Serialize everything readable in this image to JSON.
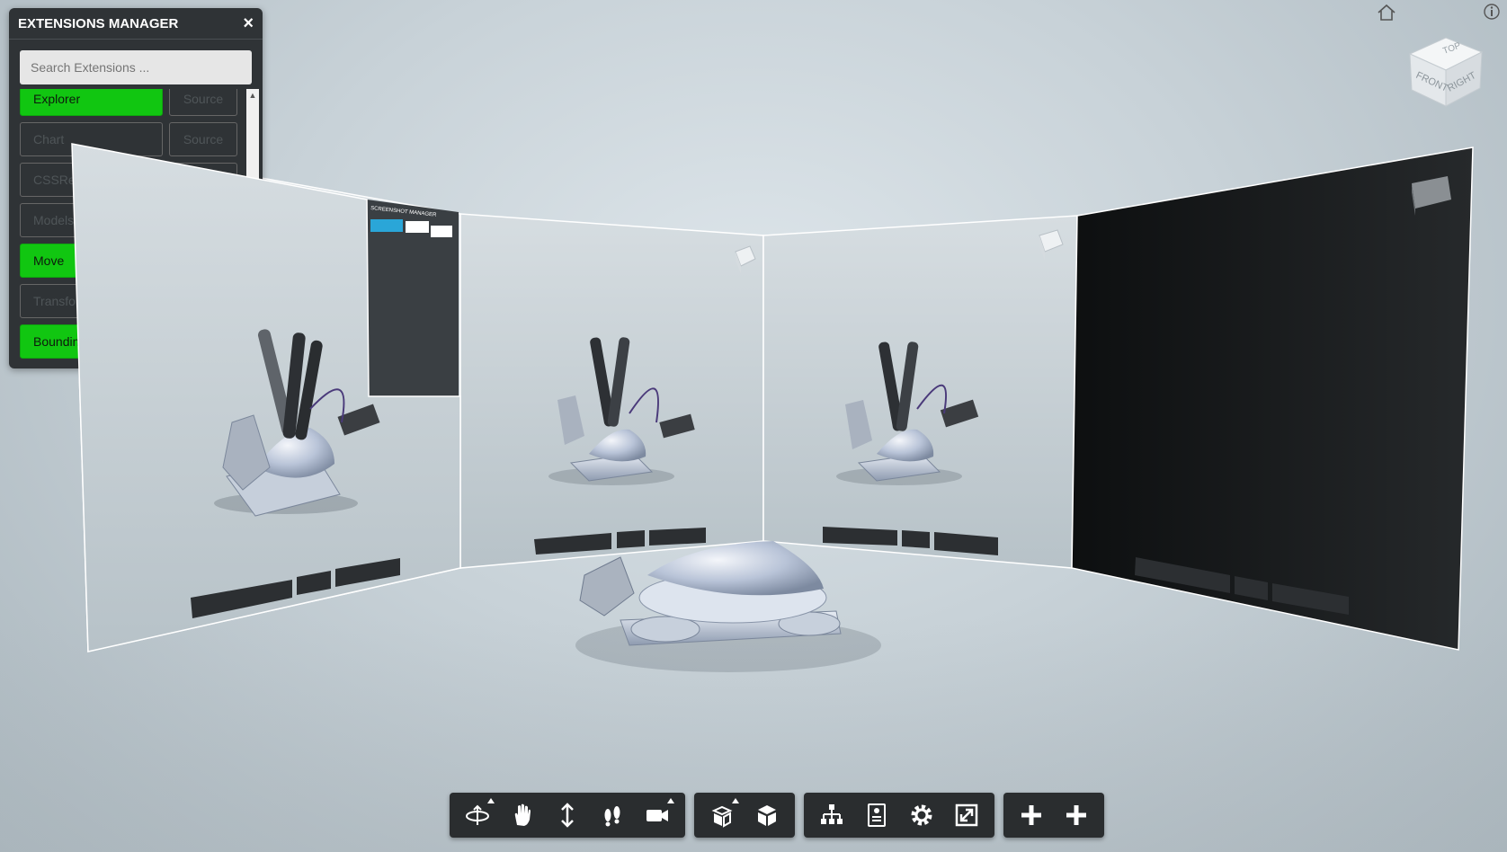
{
  "extensions_manager": {
    "title": "EXTENSIONS MANAGER",
    "close_icon": "×",
    "search_placeholder": "Search Extensions ...",
    "items": [
      {
        "label": "Explorer",
        "active": true,
        "source": "Source"
      },
      {
        "label": "Chart",
        "active": false,
        "source": "Source"
      },
      {
        "label": "CSSRe",
        "active": false,
        "source": ""
      },
      {
        "label": "Models",
        "active": false,
        "source": ""
      },
      {
        "label": "Move",
        "active": true,
        "source": ""
      },
      {
        "label": "Transfo",
        "active": false,
        "source": ""
      },
      {
        "label": "Boundin",
        "active": true,
        "source": ""
      }
    ]
  },
  "view_cube": {
    "top": "TOP",
    "front": "FRONT",
    "right": "RIGHT"
  },
  "screenshot_manager_title": "SCREENSHOT MANAGER",
  "toolbar": {
    "groups": [
      [
        "orbit-icon",
        "pan-icon",
        "dolly-icon",
        "walk-icon",
        "camera-icon"
      ],
      [
        "explode-icon",
        "cube-icon"
      ],
      [
        "model-tree-icon",
        "properties-icon",
        "settings-icon",
        "fullscreen-icon"
      ],
      [
        "plus-icon",
        "plus-icon"
      ]
    ]
  },
  "colors": {
    "accent_green": "#11c611",
    "panel_bg": "#2f3336",
    "toolbar_bg": "#2a2d2f"
  }
}
